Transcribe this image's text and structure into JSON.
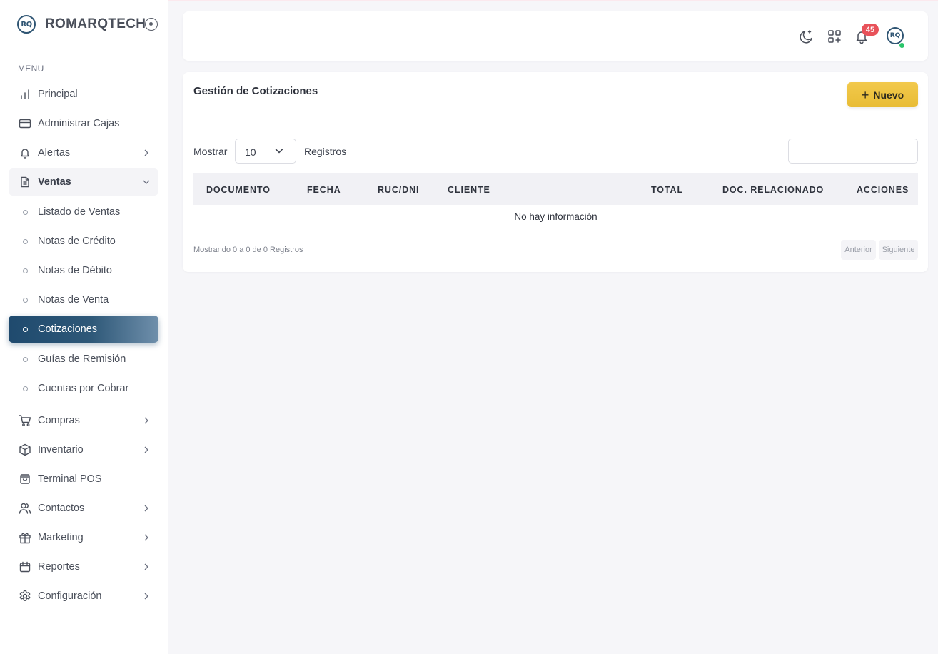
{
  "brand": {
    "logo_text": "RQ",
    "name": "ROMARQTECH"
  },
  "sidebar": {
    "menu_label": "MENU",
    "items": [
      {
        "label": "Principal",
        "icon": "bar-chart-icon"
      },
      {
        "label": "Administrar Cajas",
        "icon": "credit-card-icon"
      },
      {
        "label": "Alertas",
        "icon": "bell-icon"
      },
      {
        "label": "Ventas",
        "icon": "document-icon",
        "expanded": true
      },
      {
        "label": "Compras",
        "icon": "cart-icon"
      },
      {
        "label": "Inventario",
        "icon": "box-icon"
      },
      {
        "label": "Terminal POS",
        "icon": "shopping-bag-icon"
      },
      {
        "label": "Contactos",
        "icon": "users-icon"
      },
      {
        "label": "Marketing",
        "icon": "gift-icon"
      },
      {
        "label": "Reportes",
        "icon": "calendar-icon"
      },
      {
        "label": "Configuración",
        "icon": "gear-icon"
      }
    ],
    "ventas_sub": [
      {
        "label": "Listado de Ventas"
      },
      {
        "label": "Notas de Crédito"
      },
      {
        "label": "Notas de Débito"
      },
      {
        "label": "Notas de Venta"
      },
      {
        "label": "Cotizaciones",
        "active": true
      },
      {
        "label": "Guías de Remisión"
      },
      {
        "label": "Cuentas por Cobrar"
      }
    ]
  },
  "header": {
    "notification_count": "45",
    "avatar_text": "RQ",
    "icons": [
      "moon-icon",
      "apps-icon",
      "bell-icon"
    ]
  },
  "main": {
    "title": "Gestión de Cotizaciones",
    "new_button": "Nuevo",
    "show_label": "Mostrar",
    "page_length": "10",
    "records_label": "Registros",
    "search_value": "",
    "columns": [
      "DOCUMENTO",
      "FECHA",
      "RUC/DNI",
      "CLIENTE",
      "TOTAL",
      "DOC. RELACIONADO",
      "ACCIONES"
    ],
    "empty_message": "No hay información",
    "info_text": "Mostrando 0 a 0 de 0 Registros",
    "prev_label": "Anterior",
    "next_label": "Siguiente"
  },
  "colors": {
    "accent": "#1f4a6e",
    "button_primary": "#f2c94c",
    "badge": "#e8525a",
    "online": "#2bc56b"
  }
}
